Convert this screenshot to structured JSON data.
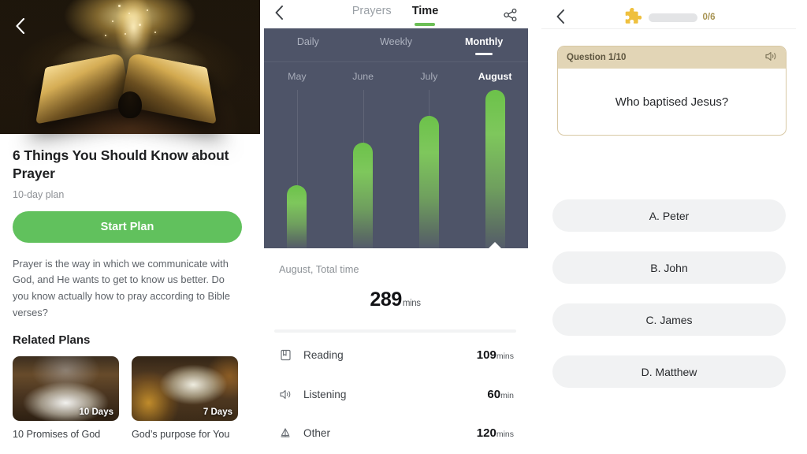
{
  "plan": {
    "back_icon": "chevron-left-icon",
    "title": "6 Things You Should Know about Prayer",
    "subtitle": "10-day plan",
    "start_button": "Start Plan",
    "description": "Prayer is the way in which we communicate with God, and He wants to get to know us better. Do you know actually how to pray according to Bible verses?",
    "related_heading": "Related Plans",
    "related": [
      {
        "badge": "10 Days",
        "name": "10 Promises of God"
      },
      {
        "badge": "7 Days",
        "name": "God’s purpose for You"
      }
    ]
  },
  "time": {
    "back_icon": "chevron-left-icon",
    "share_icon": "share-icon",
    "tabs": [
      {
        "label": "Prayers",
        "active": false
      },
      {
        "label": "Time",
        "active": true
      }
    ],
    "ranges": [
      {
        "label": "Daily",
        "active": false
      },
      {
        "label": "Weekly",
        "active": false
      },
      {
        "label": "Monthly",
        "active": true
      }
    ],
    "total_label": "August, Total time",
    "total_value": "289",
    "total_unit": "mins",
    "stats": [
      {
        "icon": "book-icon",
        "name": "Reading",
        "value": "109",
        "unit": "mins"
      },
      {
        "icon": "speaker-icon",
        "name": "Listening",
        "value": "60",
        "unit": "min"
      },
      {
        "icon": "scales-icon",
        "name": "Other",
        "value": "120",
        "unit": "mins"
      }
    ],
    "accent_color": "#6dbf57",
    "chart_bg": "#4e5468"
  },
  "chart_data": {
    "type": "bar",
    "title": "August, Total time",
    "categories": [
      "May",
      "June",
      "July",
      "August"
    ],
    "values": [
      95,
      160,
      200,
      240
    ],
    "unit": "mins",
    "selected_category": "August",
    "xlabel": "",
    "ylabel": "",
    "ylim": [
      0,
      240
    ],
    "grid": true,
    "legend": false,
    "bar_color": "#6cc24a",
    "background": "#4e5468"
  },
  "quiz": {
    "back_icon": "chevron-left-icon",
    "puzzle_icon": "puzzle-piece-icon",
    "progress_text": "0/6",
    "progress_value": 0,
    "progress_max": 6,
    "question_number": "Question 1/10",
    "speaker_icon": "speaker-icon",
    "question": "Who baptised Jesus?",
    "answers": [
      "A. Peter",
      "B. John",
      "C. James",
      "D. Matthew"
    ],
    "card_border_color": "#d8c8a4",
    "card_header_color": "#e2d5b6"
  }
}
